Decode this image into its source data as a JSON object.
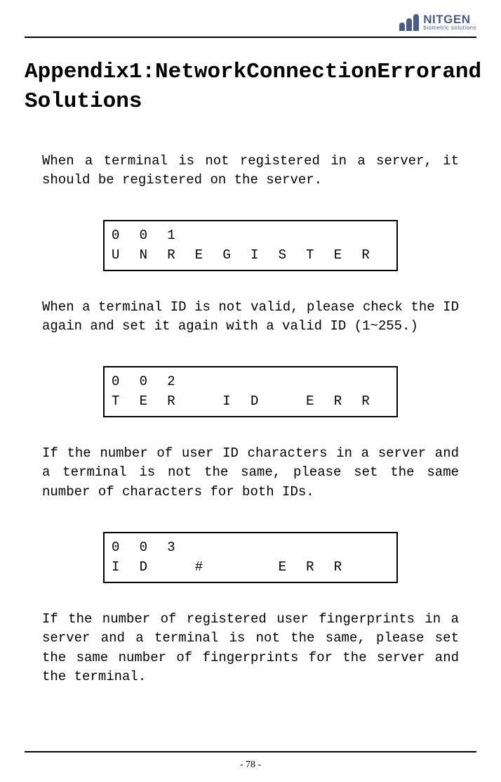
{
  "logo": {
    "name": "NITGEN",
    "subtitle": "biometric solutions"
  },
  "title": {
    "line1_words": [
      "Appendix",
      "1:",
      "Network",
      "Connection",
      "Error",
      "and"
    ],
    "line2": "Solutions"
  },
  "sections": [
    {
      "para": "When a terminal is not registered in a server, it should be registered on the server.",
      "display": {
        "row1": [
          "0",
          "0",
          "1",
          "",
          "",
          "",
          "",
          "",
          "",
          ""
        ],
        "row2": [
          "U",
          "N",
          "R",
          "E",
          "G",
          "I",
          "S",
          "T",
          "E",
          "R"
        ]
      }
    },
    {
      "para": "When a terminal ID is not valid, please check the ID again and set it again with a valid ID (1~255.)",
      "display": {
        "row1": [
          "0",
          "0",
          "2",
          "",
          "",
          "",
          "",
          "",
          "",
          ""
        ],
        "row2": [
          "T",
          "E",
          "R",
          "",
          "I",
          "D",
          "",
          "E",
          "R",
          "R"
        ]
      }
    },
    {
      "para": "If the number of user ID characters in a server and a terminal is not the same, please set the same number of characters for both IDs.",
      "display": {
        "row1": [
          "0",
          "0",
          "3",
          "",
          "",
          "",
          "",
          "",
          "",
          ""
        ],
        "row2": [
          "I",
          "D",
          "",
          "#",
          "",
          "",
          "E",
          "R",
          "R",
          ""
        ]
      }
    },
    {
      "para": "If the number of registered user fingerprints in a server and a terminal is not the same, please set the same number of fingerprints for the server and the terminal."
    }
  ],
  "page_number": "- 78 -"
}
